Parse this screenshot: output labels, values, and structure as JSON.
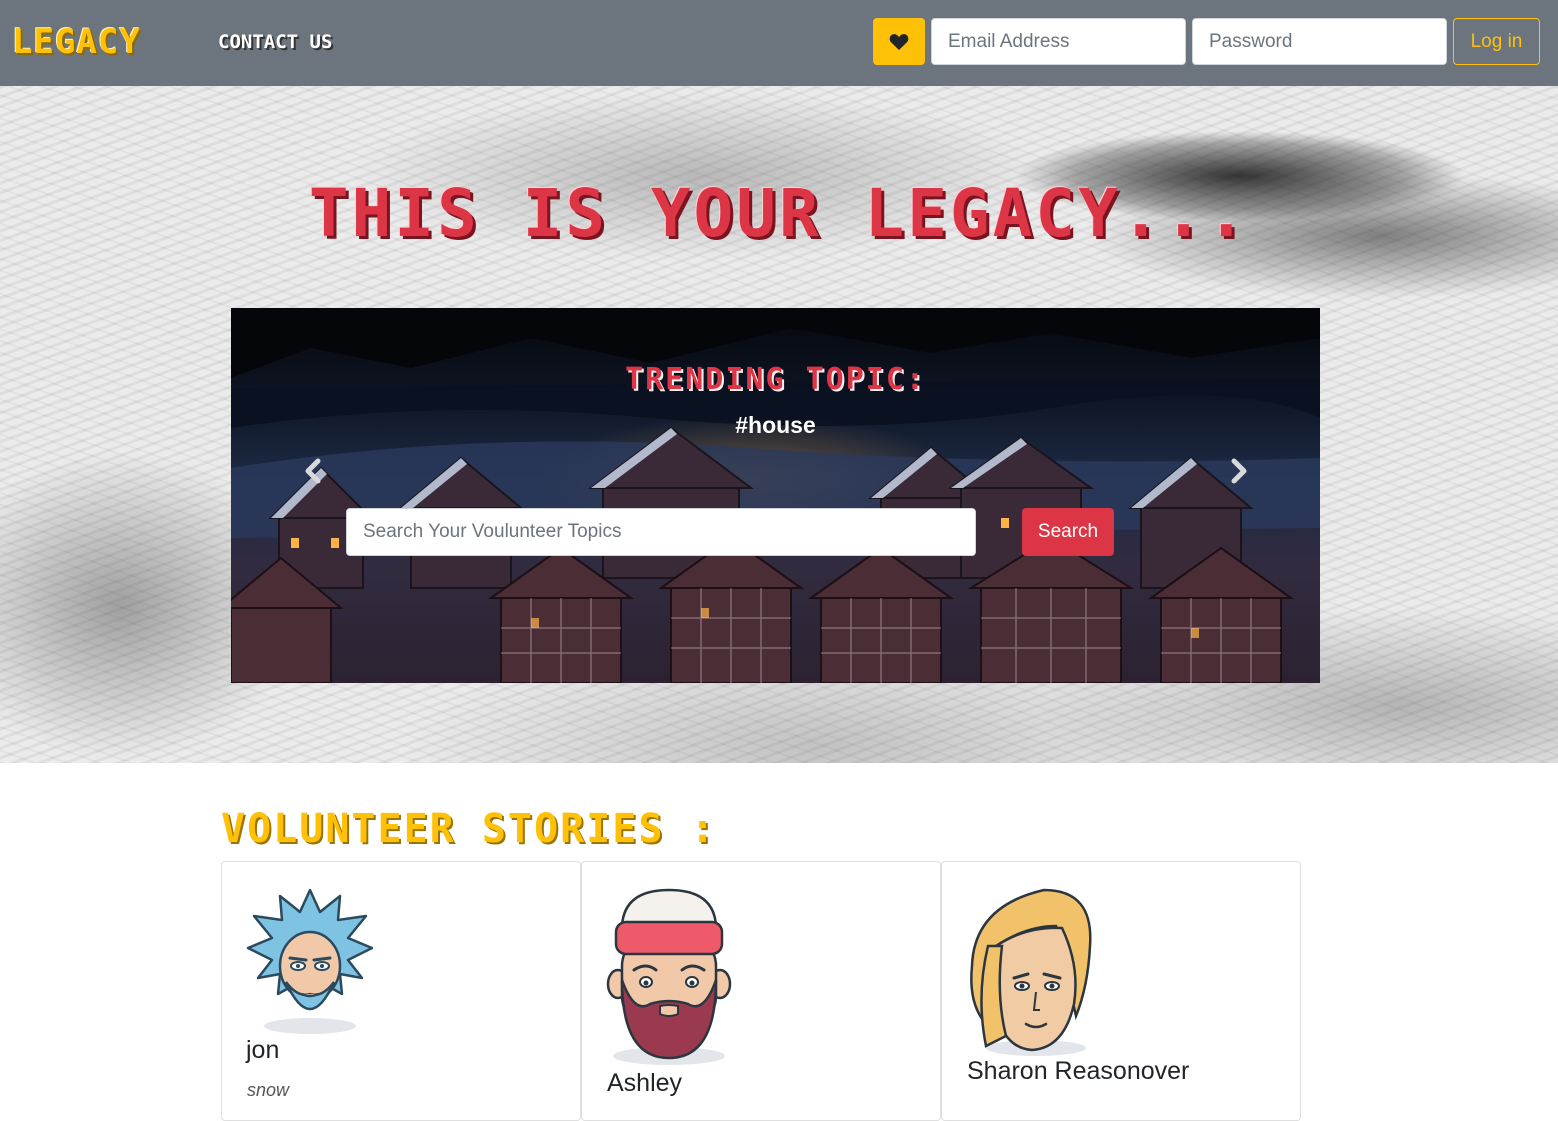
{
  "navbar": {
    "brand": "LEGACY",
    "contact_link": "CONTACT US",
    "favorites_icon": "heart-icon",
    "email_placeholder": "Email Address",
    "password_placeholder": "Password",
    "login_label": "Log in"
  },
  "hero": {
    "title": "THIS IS YOUR LEGACY...",
    "carousel": {
      "trending_label": "TRENDING TOPIC:",
      "trending_tag": "#house",
      "prev_icon": "chevron-left-icon",
      "next_icon": "chevron-right-icon",
      "search_placeholder": "Search Your Voulunteer Topics",
      "search_label": "Search"
    }
  },
  "stories": {
    "heading": "VOLUNTEER STORIES :",
    "cards": [
      {
        "name": "jon",
        "subtitle": "snow",
        "avatar_icon": "scientist-avatar-icon"
      },
      {
        "name": "Ashley",
        "subtitle": "",
        "avatar_icon": "bearded-beanie-avatar-icon"
      },
      {
        "name": "Sharon Reasonover",
        "subtitle": "",
        "avatar_icon": "blonde-woman-avatar-icon"
      }
    ]
  },
  "colors": {
    "navbar_bg": "#6c757d",
    "warning": "#ffc107",
    "danger": "#dc3545"
  }
}
